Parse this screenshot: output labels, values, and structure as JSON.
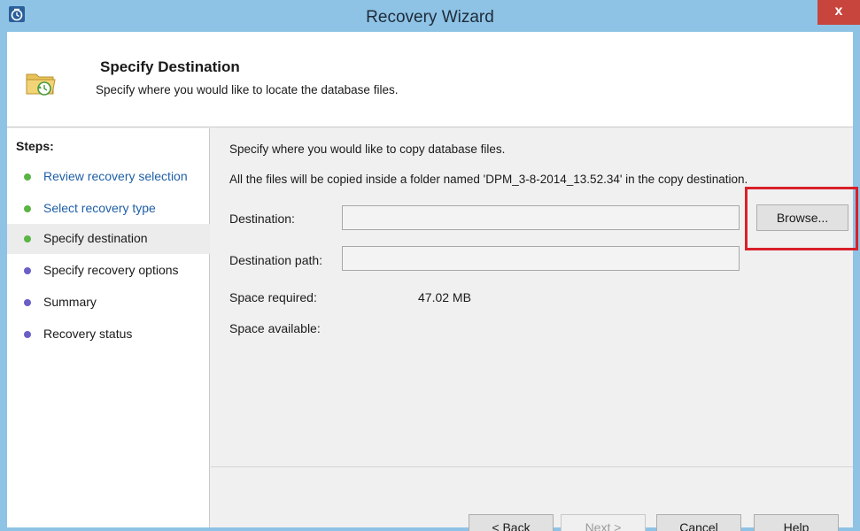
{
  "window": {
    "title": "Recovery Wizard",
    "close_label": "x",
    "colors": {
      "titlebar": "#8ec3e6",
      "close": "#c7453d",
      "highlight": "#d8202a"
    }
  },
  "header": {
    "icon": "folder-restore-icon",
    "title": "Specify Destination",
    "subtitle": "Specify where you would like to locate the database files."
  },
  "steps": {
    "heading": "Steps:",
    "items": [
      {
        "label": "Review recovery selection",
        "state": "done"
      },
      {
        "label": "Select recovery type",
        "state": "done"
      },
      {
        "label": "Specify destination",
        "state": "current"
      },
      {
        "label": "Specify recovery options",
        "state": "pending"
      },
      {
        "label": "Summary",
        "state": "pending"
      },
      {
        "label": "Recovery status",
        "state": "pending"
      }
    ]
  },
  "main": {
    "intro": "Specify where you would like to copy database files.",
    "note": "All the files will be copied inside a folder named 'DPM_3-8-2014_13.52.34' in the copy destination.",
    "destination_label": "Destination:",
    "destination_value": "",
    "browse_label": "Browse...",
    "destination_path_label": "Destination path:",
    "destination_path_value": "",
    "space_required_label": "Space required:",
    "space_required_value": "47.02 MB",
    "space_available_label": "Space available:",
    "space_available_value": ""
  },
  "footer": {
    "back_label": "< Back",
    "next_label": "Next >",
    "cancel_label": "Cancel",
    "help_label": "Help"
  }
}
